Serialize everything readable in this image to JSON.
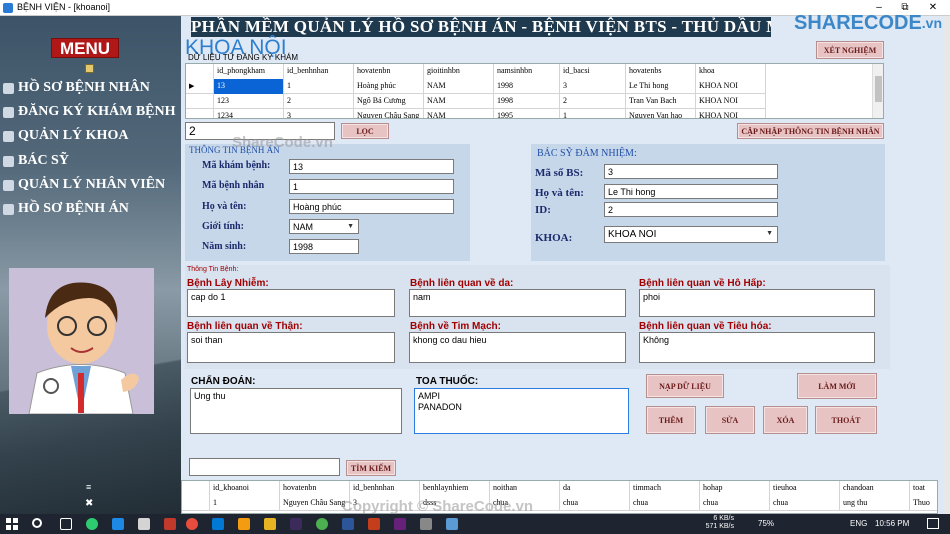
{
  "window": {
    "title": "BỆNH VIỆN - [khoanoi]",
    "minimize": "–",
    "maximize": "⧉",
    "close": "✕"
  },
  "banner": "PHẦN MỀM QUẢN LÝ HỒ SƠ BỆNH ÁN - BỆNH VIỆN BTS - THỦ DẦU MỘT",
  "logo": {
    "text": "SHARECODE",
    "suffix": ".vn"
  },
  "sidebar": {
    "menu_title": "MENU",
    "items": [
      {
        "label": "HỒ SƠ BỆNH NHÂN",
        "icon": "patient-icon"
      },
      {
        "label": "ĐĂNG KÝ KHÁM BỆNH",
        "icon": "register-icon"
      },
      {
        "label": "QUẢN LÝ KHOA",
        "icon": "department-icon"
      },
      {
        "label": "BÁC SỸ",
        "icon": "doctor-icon"
      },
      {
        "label": "QUẢN LÝ NHÂN VIÊN",
        "icon": "staff-icon"
      },
      {
        "label": "HỒ SƠ BỆNH ÁN",
        "icon": "record-icon"
      }
    ]
  },
  "page_title": "KHOA NỘI",
  "top_grid": {
    "label": "DỮ LIỆU TỪ ĐĂNG KÝ KHÁM",
    "columns": [
      "id_phongkham",
      "id_benhnhan",
      "hovatenbn",
      "gioitinhbn",
      "namsinhbn",
      "id_bacsi",
      "hovatenbs",
      "khoa"
    ],
    "rows": [
      [
        "13",
        "1",
        "Hoàng phúc",
        "NAM",
        "1998",
        "3",
        "Le Thi hong",
        "KHOA NOI"
      ],
      [
        "123",
        "2",
        "Ngô Bá Cương",
        "NAM",
        "1998",
        "2",
        "Tran Van Bach",
        "KHOA NOI"
      ],
      [
        "1234",
        "3",
        "Nguyen Châu Sang",
        "NAM",
        "1995",
        "1",
        "Nguyen Van hao",
        "KHOA NOI"
      ]
    ],
    "selected_indicator": "▶"
  },
  "buttons": {
    "xet_nghiem": "XÉT NGHIỆM",
    "loc": "LỌC",
    "cap_nhap": "CẬP NHẬP THÔNG TIN BỆNH NHÂN",
    "nap_du_lieu": "NẠP DỮ LIỆU",
    "lam_moi": "LÀM MỚI",
    "them": "THÊM",
    "sua": "SỬA",
    "xoa": "XÓA",
    "thoat": "THOÁT",
    "tim_kiem": "TÌM KIẾM"
  },
  "filter_value": "2",
  "benh_an": {
    "section": "THÔNG TIN BỆNH ÁN",
    "ma_kham_label": "Mã khám bệnh:",
    "ma_kham": "13",
    "ma_bn_label": "Mã bệnh nhân",
    "ma_bn": "1",
    "ho_ten_label": "Họ và tên:",
    "ho_ten": "Hoàng phúc",
    "gioi_tinh_label": "Giới tính:",
    "gioi_tinh": "NAM",
    "nam_sinh_label": "Năm sinh:",
    "nam_sinh": "1998"
  },
  "bac_si": {
    "section": "BÁC SỸ ĐẢM NHIỆM:",
    "ma_bs_label": "Mã số BS:",
    "ma_bs": "3",
    "ho_ten_label": "Họ và tên:",
    "ho_ten": "Le Thi hong",
    "id_label": "ID:",
    "id": "2",
    "khoa_label": "KHOA:",
    "khoa": "KHOA NOI"
  },
  "thong_tin_benh": {
    "section": "Thông Tin Bệnh:",
    "lay_nhiem_label": "Bệnh Lây Nhiễm:",
    "lay_nhiem": "cap do 1",
    "da_label": "Bệnh liên quan về da:",
    "da": "nam",
    "ho_hap_label": "Bệnh liên quan về Hô Hấp:",
    "ho_hap": "phoi",
    "than_label": "Bệnh liên quan về Thận:",
    "than": "soi than",
    "tim_mach_label": "Bệnh về Tim Mạch:",
    "tim_mach": "khong co dau hieu",
    "tieu_hoa_label": "Bệnh liên quan về Tiêu hóa:",
    "tieu_hoa": "Không"
  },
  "chan_doan": {
    "label": "CHẨN ĐOÁN:",
    "value": "Ung thu"
  },
  "toa_thuoc": {
    "label": "TOA THUỐC:",
    "value": "AMPI\nPANADON"
  },
  "search_value": "",
  "bottom_grid": {
    "columns": [
      "id_khoanoi",
      "hovatenbn",
      "id_benhnhan",
      "benhlaynhiem",
      "noithan",
      "da",
      "timmach",
      "hohap",
      "tieuhoa",
      "chandoan",
      "toat"
    ],
    "rows": [
      [
        "1",
        "Nguyen Châu Sang",
        "3",
        "dsss",
        "chua",
        "chua",
        "chua",
        "chua",
        "chua",
        "ung thu",
        "Thuo"
      ]
    ]
  },
  "taskbar": {
    "net_up": "6 KB/s",
    "net_down": "571 KB/s",
    "battery": "75%",
    "lang": "ENG",
    "time": "10:56 PM"
  },
  "watermarks": [
    "ShareCode.vn",
    "Copyright © ShareCode.vn"
  ]
}
